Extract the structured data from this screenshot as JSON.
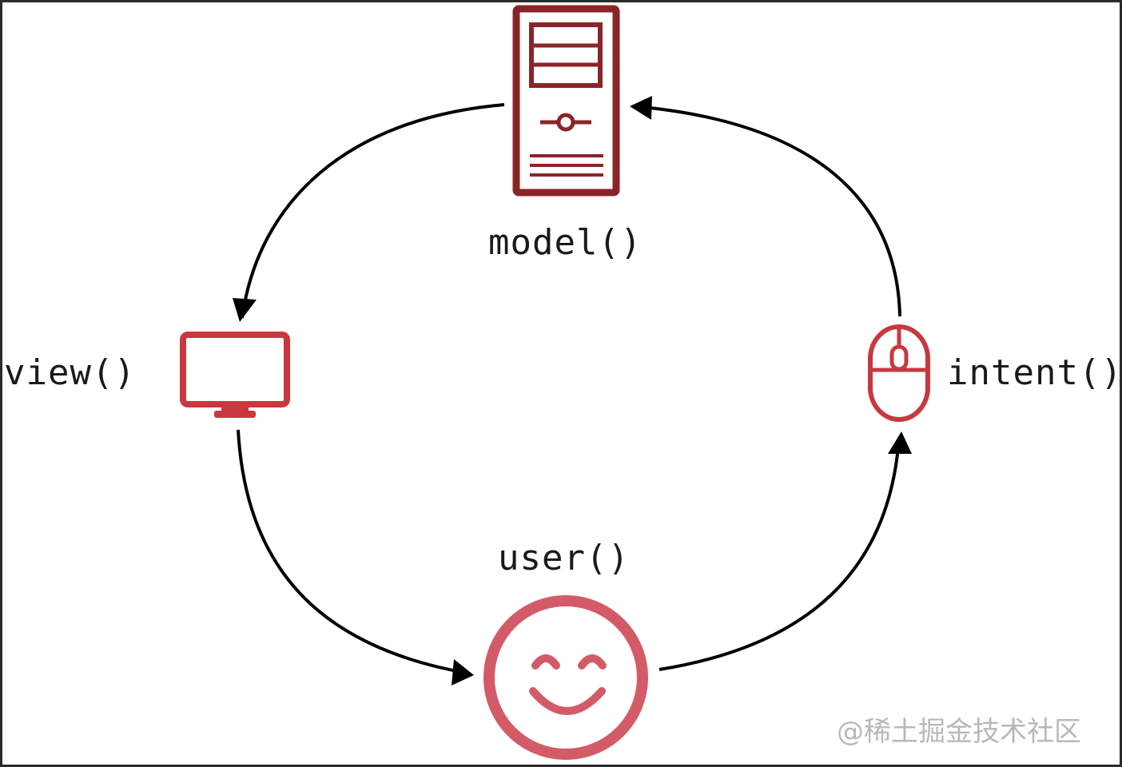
{
  "nodes": {
    "model": {
      "label": "model()",
      "icon": "server-icon",
      "color": "#8b2428"
    },
    "view": {
      "label": "view()",
      "icon": "monitor-icon",
      "color": "#c9383f"
    },
    "intent": {
      "label": "intent()",
      "icon": "mouse-icon",
      "color": "#c9383f"
    },
    "user": {
      "label": "user()",
      "icon": "smiley-icon",
      "color": "#d35b68"
    }
  },
  "edges": [
    {
      "from": "model",
      "to": "view"
    },
    {
      "from": "view",
      "to": "user"
    },
    {
      "from": "user",
      "to": "intent"
    },
    {
      "from": "intent",
      "to": "model"
    }
  ],
  "watermark": "@稀土掘金技术社区"
}
